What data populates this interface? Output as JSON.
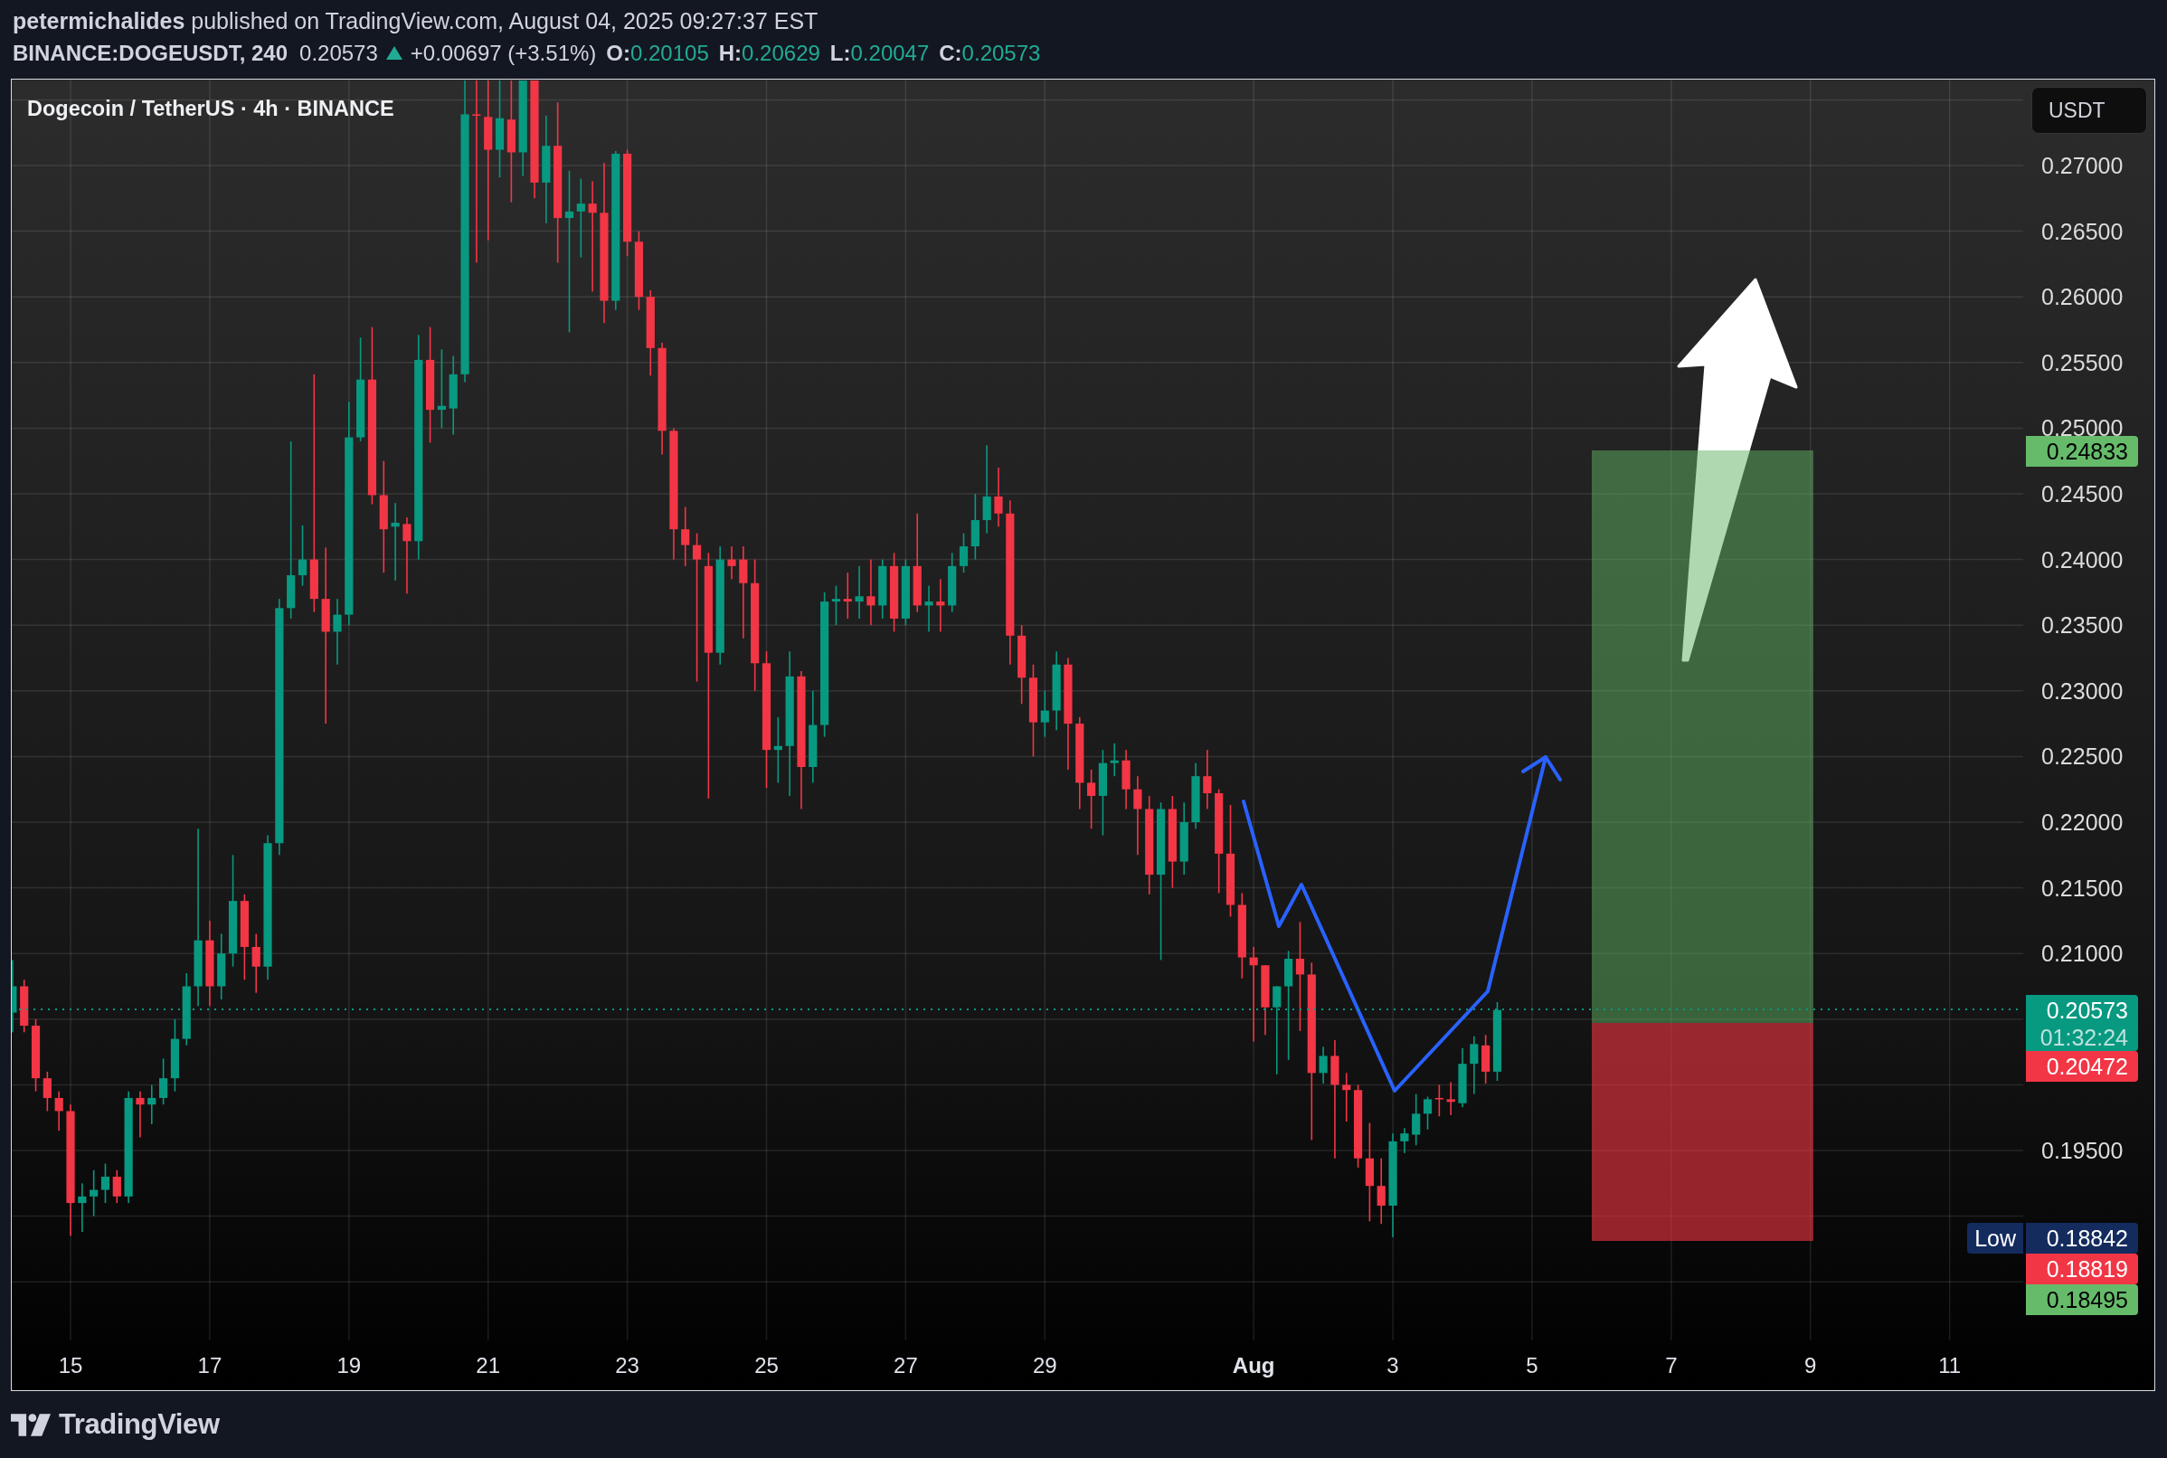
{
  "header": {
    "publish_line": "**petermichalides** published on TradingView.com, August 04, 2025 09:27:37 EST",
    "symbol": "BINANCE:DOGEUSDT, 240",
    "last_price": "0.20573",
    "rising": true,
    "change": "+0.00697 (+3.51%)",
    "ohlc": [
      {
        "label": "O:",
        "value": "0.20105"
      },
      {
        "label": "H:",
        "value": "0.20629"
      },
      {
        "label": "L:",
        "value": "0.20047"
      },
      {
        "label": "C:",
        "value": "0.20573"
      }
    ]
  },
  "chart": {
    "title": "Dogecoin / TetherUS · 4h · BINANCE",
    "currency": "USDT",
    "price_ticks": [
      "0.27000",
      "0.26500",
      "0.26000",
      "0.25500",
      "0.25000",
      "0.24500",
      "0.24000",
      "0.23500",
      "0.23000",
      "0.22500",
      "0.22000",
      "0.21500",
      "0.21000",
      "0.19500"
    ],
    "price_labels": [
      {
        "value": "0.24833",
        "color": "#66bb6a"
      },
      {
        "value": "0.20573",
        "countdown": "01:32:24",
        "color": "#089981"
      },
      {
        "value": "0.20472",
        "color": "#f23645"
      },
      {
        "tag": "Low",
        "value": "0.18842",
        "color": "#142b5e"
      },
      {
        "value": "0.18819",
        "color": "#f23645"
      },
      {
        "value": "0.18495",
        "color": "#66bb6a"
      }
    ],
    "time_ticks": [
      {
        "label": "15",
        "kind": "day"
      },
      {
        "label": "17",
        "kind": "day"
      },
      {
        "label": "19",
        "kind": "day"
      },
      {
        "label": "21",
        "kind": "day"
      },
      {
        "label": "23",
        "kind": "day"
      },
      {
        "label": "25",
        "kind": "day"
      },
      {
        "label": "27",
        "kind": "day"
      },
      {
        "label": "29",
        "kind": "day"
      },
      {
        "label": "Aug",
        "kind": "month"
      },
      {
        "label": "3",
        "kind": "day"
      },
      {
        "label": "5",
        "kind": "day"
      },
      {
        "label": "7",
        "kind": "day"
      },
      {
        "label": "9",
        "kind": "day"
      },
      {
        "label": "11",
        "kind": "day"
      }
    ]
  },
  "footer": {
    "brand": "TradingView"
  }
}
